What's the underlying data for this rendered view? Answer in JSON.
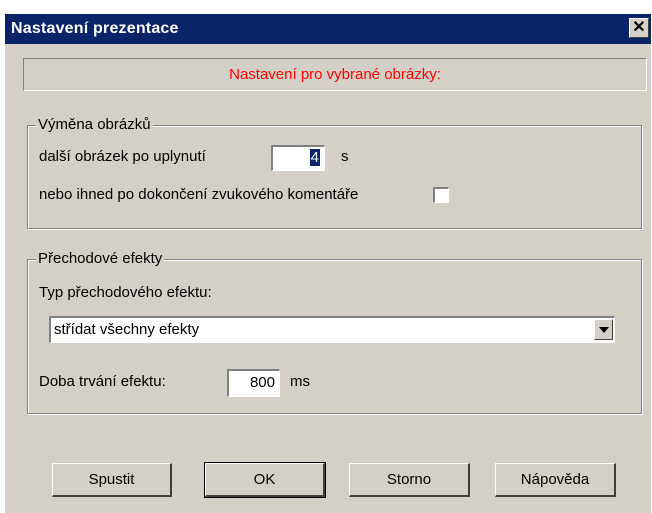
{
  "window": {
    "title": "Nastavení prezentace",
    "close_glyph": "✕"
  },
  "header": {
    "text": "Nastavení pro vybrané obrázky:",
    "color": "#ff0000"
  },
  "image_change": {
    "group_label": "Výměna obrázků",
    "next_after_label": "další obrázek po uplynutí",
    "interval_value": "4",
    "interval_unit": "s",
    "or_after_audio_label": "nebo ihned po dokončení zvukového komentáře",
    "or_after_audio_checked": false
  },
  "transitions": {
    "group_label": "Přechodové efekty",
    "type_label": "Typ přechodového efektu:",
    "type_value": "střídat všechny efekty",
    "duration_label": "Doba trvání efektu:",
    "duration_value": "800",
    "duration_unit": "ms"
  },
  "buttons": {
    "start": "Spustit",
    "ok": "OK",
    "cancel": "Storno",
    "help": "Nápověda"
  },
  "colors": {
    "titlebar": "#0a246a",
    "dialog_bg": "#d4d0c8",
    "selection": "#0a246a"
  }
}
